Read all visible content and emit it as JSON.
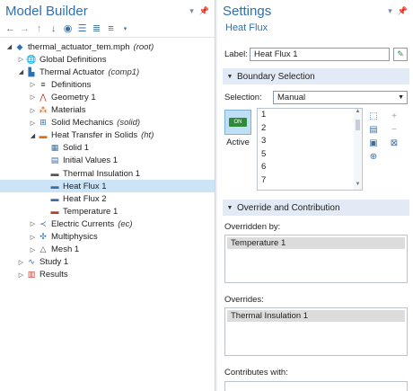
{
  "left": {
    "title": "Model Builder",
    "tree": [
      {
        "label": "thermal_actuator_tem.mph",
        "tag": "(root)",
        "depth": 0,
        "twisty": "open",
        "icon": "model-icon"
      },
      {
        "label": "Global Definitions",
        "tag": "",
        "depth": 1,
        "twisty": "closed",
        "icon": "globe-icon"
      },
      {
        "label": "Thermal Actuator",
        "tag": "(comp1)",
        "depth": 1,
        "twisty": "open",
        "icon": "component-icon"
      },
      {
        "label": "Definitions",
        "tag": "",
        "depth": 2,
        "twisty": "closed",
        "icon": "definitions-icon"
      },
      {
        "label": "Geometry 1",
        "tag": "",
        "depth": 2,
        "twisty": "closed",
        "icon": "geometry-icon"
      },
      {
        "label": "Materials",
        "tag": "",
        "depth": 2,
        "twisty": "closed",
        "icon": "materials-icon"
      },
      {
        "label": "Solid Mechanics",
        "tag": "(solid)",
        "depth": 2,
        "twisty": "closed",
        "icon": "solid-mechanics-icon"
      },
      {
        "label": "Heat Transfer in Solids",
        "tag": "(ht)",
        "depth": 2,
        "twisty": "open",
        "icon": "heat-transfer-icon"
      },
      {
        "label": "Solid 1",
        "tag": "",
        "depth": 3,
        "twisty": "",
        "icon": "solid-icon"
      },
      {
        "label": "Initial Values 1",
        "tag": "",
        "depth": 3,
        "twisty": "",
        "icon": "initial-values-icon"
      },
      {
        "label": "Thermal Insulation 1",
        "tag": "",
        "depth": 3,
        "twisty": "",
        "icon": "thermal-insulation-icon"
      },
      {
        "label": "Heat Flux 1",
        "tag": "",
        "depth": 3,
        "twisty": "",
        "icon": "heat-flux-icon",
        "selected": true
      },
      {
        "label": "Heat Flux 2",
        "tag": "",
        "depth": 3,
        "twisty": "",
        "icon": "heat-flux-icon"
      },
      {
        "label": "Temperature 1",
        "tag": "",
        "depth": 3,
        "twisty": "",
        "icon": "temperature-icon"
      },
      {
        "label": "Electric Currents",
        "tag": "(ec)",
        "depth": 2,
        "twisty": "closed",
        "icon": "electric-currents-icon"
      },
      {
        "label": "Multiphysics",
        "tag": "",
        "depth": 2,
        "twisty": "closed",
        "icon": "multiphysics-icon"
      },
      {
        "label": "Mesh 1",
        "tag": "",
        "depth": 2,
        "twisty": "closed",
        "icon": "mesh-icon"
      },
      {
        "label": "Study 1",
        "tag": "",
        "depth": 1,
        "twisty": "closed",
        "icon": "study-icon"
      },
      {
        "label": "Results",
        "tag": "",
        "depth": 1,
        "twisty": "closed",
        "icon": "results-icon"
      }
    ]
  },
  "right": {
    "title": "Settings",
    "subtitle": "Heat Flux",
    "label_caption": "Label:",
    "label_value": "Heat Flux 1",
    "boundary_section": "Boundary Selection",
    "selection_caption": "Selection:",
    "selection_value": "Manual",
    "active_toggle": "ON",
    "active_caption": "Active",
    "boundaries": [
      "1",
      "2",
      "3",
      "5",
      "6",
      "7"
    ],
    "override_section": "Override and Contribution",
    "overridden_by_caption": "Overridden by:",
    "overridden_by": "Temperature 1",
    "overrides_caption": "Overrides:",
    "overrides": "Thermal Insulation 1",
    "contributes_caption": "Contributes with:"
  },
  "colors": {
    "accent": "#2f6fb0",
    "selection": "#cce4f7",
    "section_header": "#e2ebf5"
  }
}
